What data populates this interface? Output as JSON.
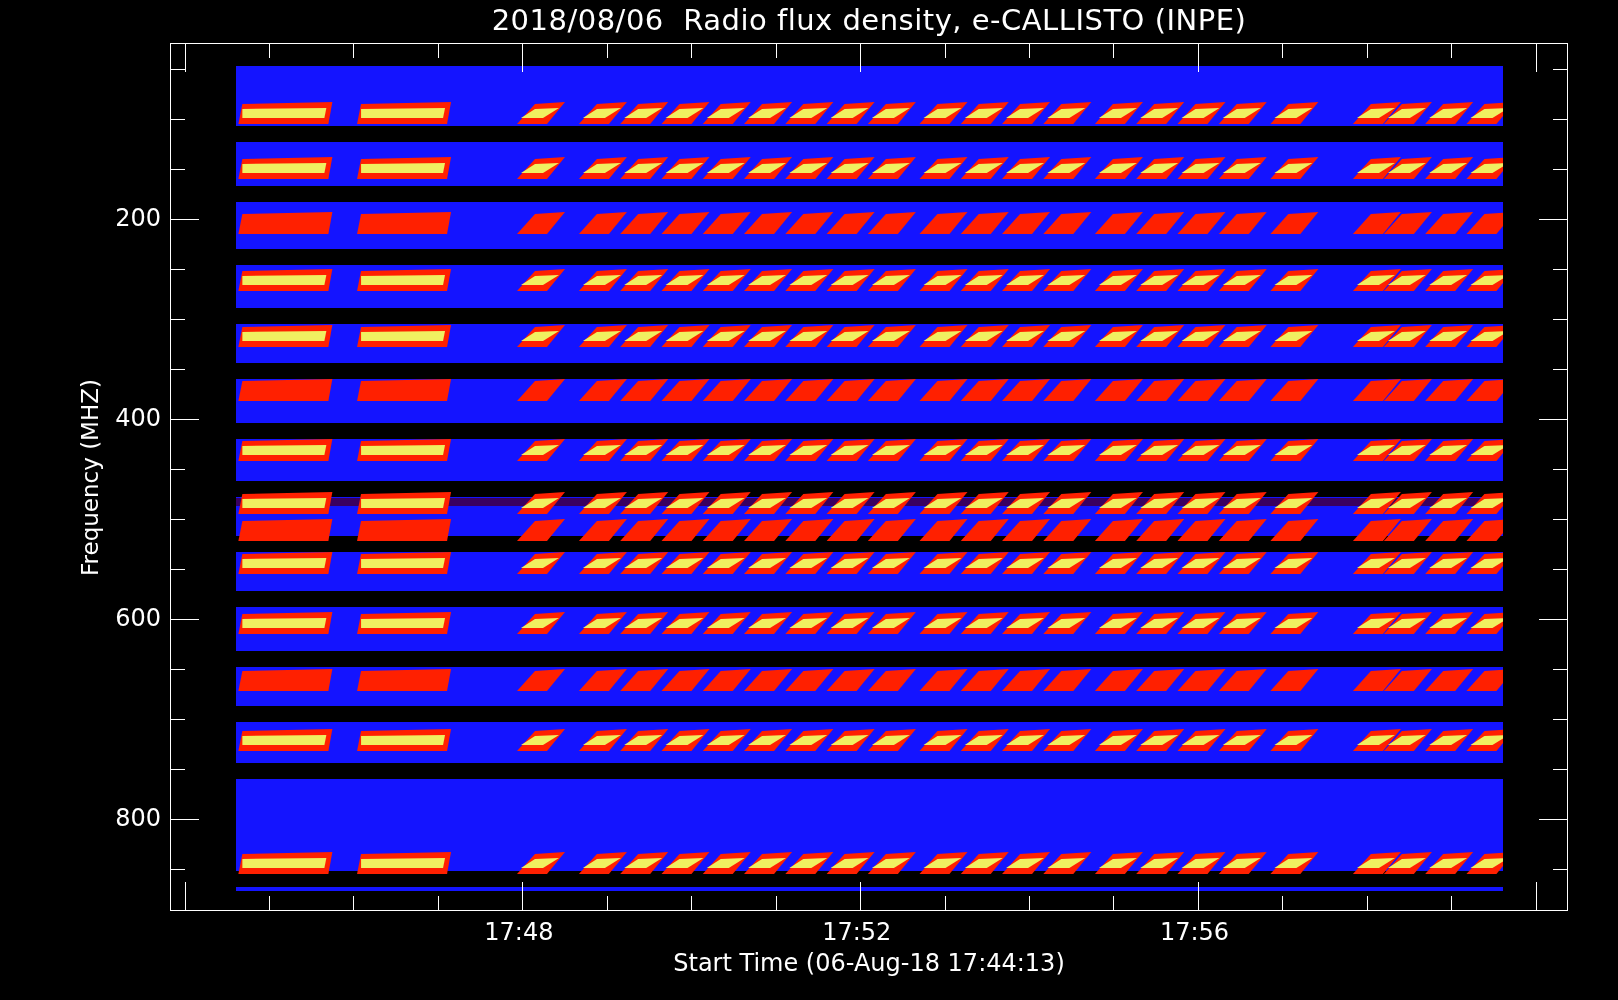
{
  "title": "2018/08/06  Radio flux density, e-CALLISTO (INPE)",
  "y_axis": {
    "label": "Frequency (MHZ)",
    "tick_labels": [
      "200",
      "400",
      "600",
      "800"
    ]
  },
  "x_axis": {
    "label": "Start Time (06-Aug-18 17:44:13)",
    "tick_labels": [
      "17:48",
      "17:52",
      "17:56"
    ]
  }
}
